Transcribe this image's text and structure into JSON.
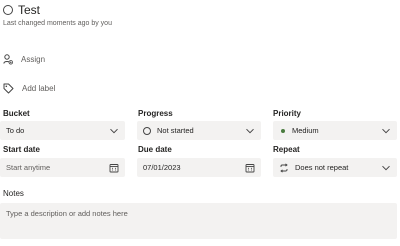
{
  "task": {
    "title": "Test",
    "last_changed": "Last changed moments ago by you"
  },
  "actions": {
    "assign_label": "Assign",
    "add_label_label": "Add label"
  },
  "fields": {
    "bucket": {
      "label": "Bucket",
      "value": "To do"
    },
    "progress": {
      "label": "Progress",
      "value": "Not started"
    },
    "priority": {
      "label": "Priority",
      "value": "Medium",
      "dot_color": "#4a7c3f"
    },
    "start_date": {
      "label": "Start date",
      "placeholder": "Start anytime"
    },
    "due_date": {
      "label": "Due date",
      "value": "07/01/2023"
    },
    "repeat": {
      "label": "Repeat",
      "value": "Does not repeat"
    }
  },
  "notes": {
    "label": "Notes",
    "placeholder": "Type a description or add notes here"
  },
  "icons": {
    "complete": "circle-checkbox-icon",
    "assign": "person-add-icon",
    "label": "tag-icon",
    "dropdown": "chevron-down-icon",
    "calendar": "calendar-icon",
    "repeat": "repeat-icon"
  }
}
